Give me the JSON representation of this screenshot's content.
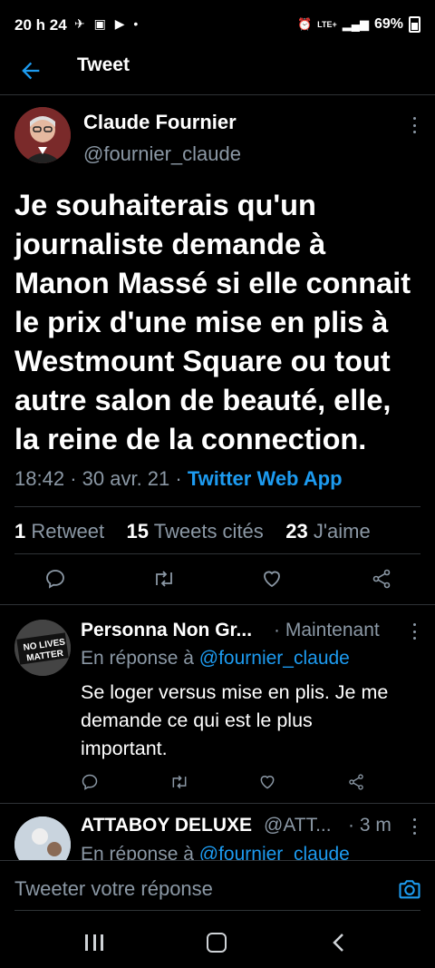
{
  "status_bar": {
    "time": "20 h 24",
    "battery": "69%",
    "network": "LTE+"
  },
  "header": {
    "title": "Tweet"
  },
  "tweet": {
    "author_name": "Claude Fournier",
    "author_handle": "@fournier_claude",
    "text": "Je souhaiterais qu'un journaliste demande à Manon Massé si elle connait le prix d'une mise en plis à Westmount Square ou tout autre salon de beauté, elle, la reine de la connection.",
    "time": "18:42",
    "date": "30 avr. 21",
    "source": "Twitter Web App",
    "stats": {
      "retweets_count": "1",
      "retweets_label": "Retweet",
      "quotes_count": "15",
      "quotes_label": "Tweets cités",
      "likes_count": "23",
      "likes_label": "J'aime"
    }
  },
  "replies": [
    {
      "name": "Personna Non Gr...",
      "time": "· Maintenant",
      "reply_to_prefix": "En réponse à",
      "reply_to_handle": "@fournier_claude",
      "text": "Se loger versus mise en plis. Je me demande ce qui est le plus important.",
      "avatar_text_1": "NO LIVES",
      "avatar_text_2": "MATTER"
    },
    {
      "name": "ATTABOY DELUXE",
      "handle": "@ATT...",
      "time": "· 3 m",
      "reply_to_prefix": "En réponse à",
      "reply_to_handle": "@fournier_claude"
    }
  ],
  "compose": {
    "placeholder": "Tweeter votre réponse"
  },
  "colors": {
    "accent": "#1d9bf0",
    "muted": "#8b98a5",
    "background": "#000000",
    "divider": "#2f3336"
  }
}
